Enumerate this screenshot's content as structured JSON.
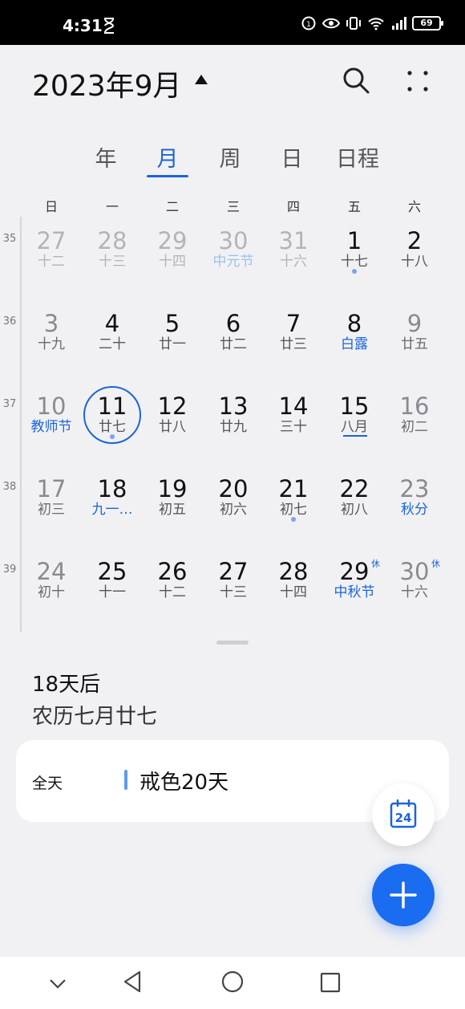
{
  "status_bar": {
    "time": "4:31",
    "battery": "69"
  },
  "header": {
    "title": "2023年9月"
  },
  "tabs": [
    "年",
    "月",
    "周",
    "日",
    "日程"
  ],
  "active_tab": "月",
  "weekdays": [
    "日",
    "一",
    "二",
    "三",
    "四",
    "五",
    "六"
  ],
  "weeks": [
    {
      "number": "35",
      "days": [
        {
          "day": "27",
          "sub": "十二",
          "muted": true
        },
        {
          "day": "28",
          "sub": "十三",
          "muted": true
        },
        {
          "day": "29",
          "sub": "十四",
          "muted": true
        },
        {
          "day": "30",
          "sub": "中元节",
          "muted": true,
          "festival": true
        },
        {
          "day": "31",
          "sub": "十六",
          "muted": true
        },
        {
          "day": "1",
          "sub": "十七",
          "dot": true
        },
        {
          "day": "2",
          "sub": "十八"
        }
      ]
    },
    {
      "number": "36",
      "days": [
        {
          "day": "3",
          "sub": "十九",
          "weekend": true
        },
        {
          "day": "4",
          "sub": "二十"
        },
        {
          "day": "5",
          "sub": "廿一"
        },
        {
          "day": "6",
          "sub": "廿二"
        },
        {
          "day": "7",
          "sub": "廿三"
        },
        {
          "day": "8",
          "sub": "白露",
          "festival": true
        },
        {
          "day": "9",
          "sub": "廿五",
          "weekend": true
        }
      ]
    },
    {
      "number": "37",
      "days": [
        {
          "day": "10",
          "sub": "教师节",
          "weekend": true,
          "festival": true
        },
        {
          "day": "11",
          "sub": "廿七",
          "today": true,
          "dot": true
        },
        {
          "day": "12",
          "sub": "廿八"
        },
        {
          "day": "13",
          "sub": "廿九"
        },
        {
          "day": "14",
          "sub": "三十"
        },
        {
          "day": "15",
          "sub": "八月",
          "underline": true
        },
        {
          "day": "16",
          "sub": "初二",
          "weekend": true
        }
      ]
    },
    {
      "number": "38",
      "days": [
        {
          "day": "17",
          "sub": "初三",
          "weekend": true
        },
        {
          "day": "18",
          "sub": "九一…",
          "festival": true
        },
        {
          "day": "19",
          "sub": "初五"
        },
        {
          "day": "20",
          "sub": "初六"
        },
        {
          "day": "21",
          "sub": "初七",
          "dot": true
        },
        {
          "day": "22",
          "sub": "初八"
        },
        {
          "day": "23",
          "sub": "秋分",
          "weekend": true,
          "festival": true
        }
      ]
    },
    {
      "number": "39",
      "days": [
        {
          "day": "24",
          "sub": "初十",
          "weekend": true
        },
        {
          "day": "25",
          "sub": "十一"
        },
        {
          "day": "26",
          "sub": "十二"
        },
        {
          "day": "27",
          "sub": "十三"
        },
        {
          "day": "28",
          "sub": "十四"
        },
        {
          "day": "29",
          "sub": "中秋节",
          "festival": true,
          "badge": "休"
        },
        {
          "day": "30",
          "sub": "十六",
          "weekend": true,
          "badge": "休"
        }
      ]
    }
  ],
  "info": {
    "days_until": "18天后",
    "lunar_date": "农历七月廿七"
  },
  "event": {
    "all_day": "全天",
    "title": "戒色20天",
    "color": "#5b9bf0"
  },
  "today_fab_label": "24",
  "colors": {
    "accent": "#1b64d8",
    "fab": "#1a6cf0"
  }
}
